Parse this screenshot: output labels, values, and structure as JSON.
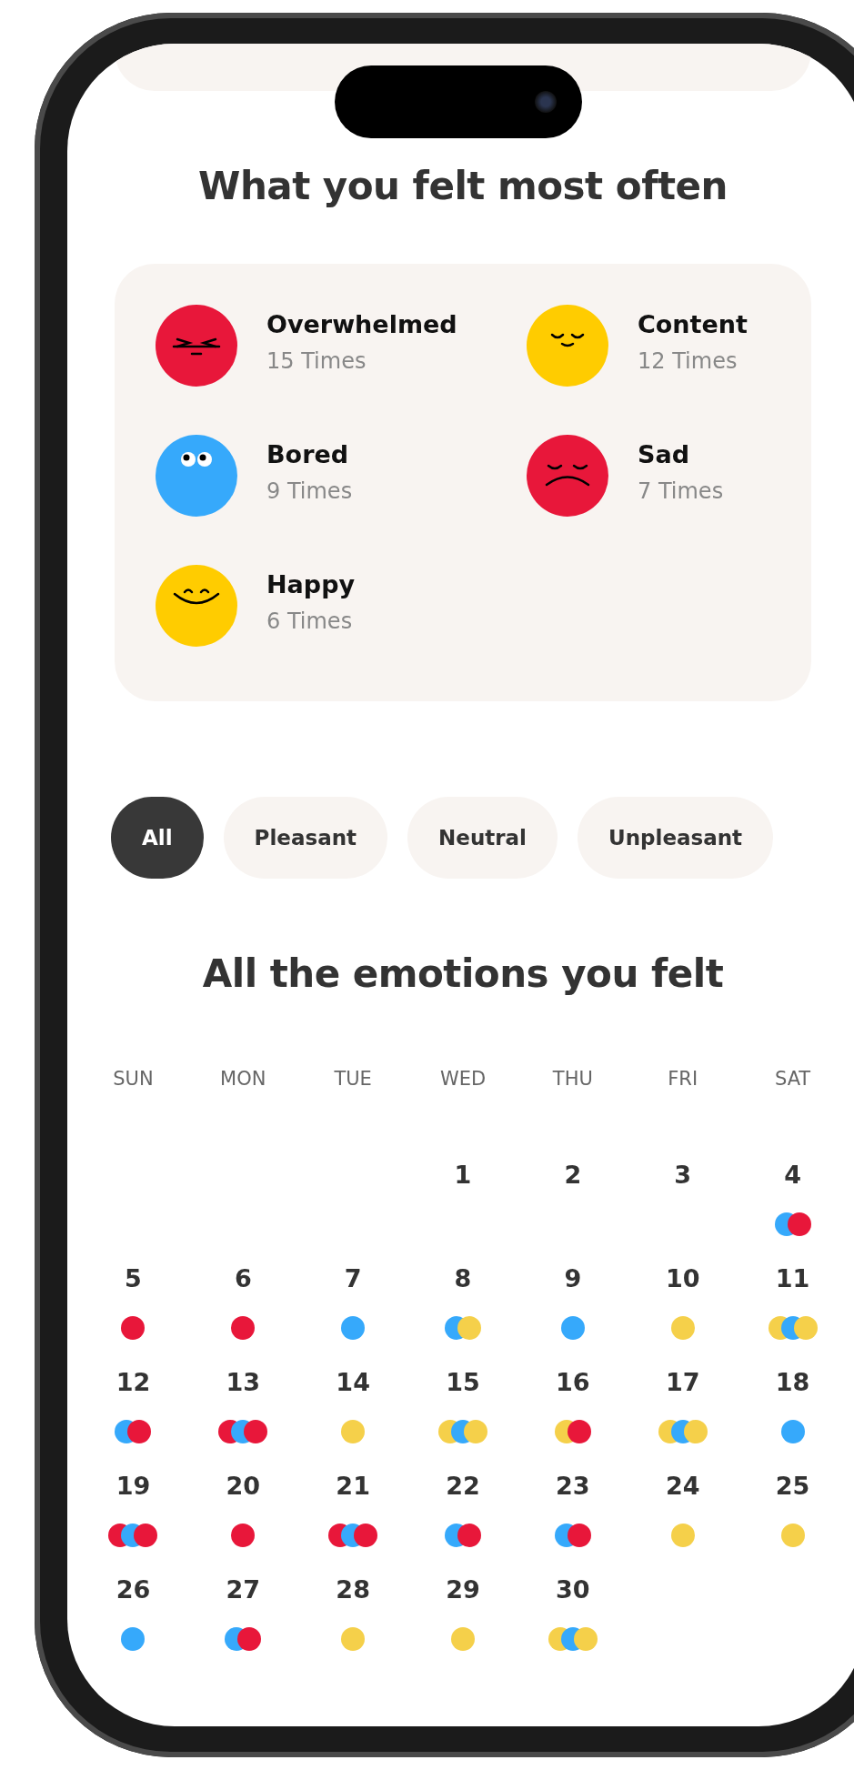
{
  "summary": {
    "title": "What you felt most often",
    "emotions": [
      {
        "name": "Overwhelmed",
        "count": "15 Times",
        "kind": "angry",
        "color": "#e8173a"
      },
      {
        "name": "Content",
        "count": "12 Times",
        "kind": "content",
        "color": "#ffcc00"
      },
      {
        "name": "Bored",
        "count": "9 Times",
        "kind": "bored",
        "color": "#36a9fb"
      },
      {
        "name": "Sad",
        "count": "7 Times",
        "kind": "sad",
        "color": "#e8173a"
      },
      {
        "name": "Happy",
        "count": "6 Times",
        "kind": "happy",
        "color": "#ffcc00"
      }
    ]
  },
  "filters": [
    {
      "label": "All",
      "selected": true
    },
    {
      "label": "Pleasant",
      "selected": false
    },
    {
      "label": "Neutral",
      "selected": false
    },
    {
      "label": "Unpleasant",
      "selected": false
    }
  ],
  "calendar": {
    "title": "All the emotions you felt",
    "weekdays": [
      "SUN",
      "MON",
      "TUE",
      "WED",
      "THU",
      "FRI",
      "SAT"
    ],
    "weeks": [
      {
        "days": [
          {
            "kind": "blank"
          },
          {
            "kind": "blank"
          },
          {
            "kind": "blank"
          },
          {
            "kind": "day",
            "date": "1"
          },
          {
            "kind": "day",
            "date": "2"
          },
          {
            "kind": "day",
            "date": "3"
          },
          {
            "kind": "day",
            "date": "4",
            "dots": [
              {
                "color": "#36a9fb"
              },
              {
                "color": "#e8173a"
              }
            ]
          }
        ]
      },
      {
        "days": [
          {
            "kind": "day",
            "date": "5",
            "dots": [
              {
                "color": "#e8173a"
              }
            ]
          },
          {
            "kind": "day",
            "date": "6",
            "dots": [
              {
                "color": "#e8173a"
              }
            ]
          },
          {
            "kind": "day",
            "date": "7",
            "dots": [
              {
                "color": "#36a9fb"
              }
            ]
          },
          {
            "kind": "day",
            "date": "8",
            "dots": [
              {
                "color": "#36a9fb"
              },
              {
                "color": "#f5d04a"
              }
            ]
          },
          {
            "kind": "day",
            "date": "9",
            "dots": [
              {
                "color": "#36a9fb"
              }
            ]
          },
          {
            "kind": "day",
            "date": "10",
            "dots": [
              {
                "color": "#f5d04a"
              }
            ]
          },
          {
            "kind": "day",
            "date": "11",
            "dots": [
              {
                "color": "#f5d04a"
              },
              {
                "color": "#36a9fb"
              },
              {
                "color": "#f5d04a"
              }
            ]
          }
        ]
      },
      {
        "days": [
          {
            "kind": "day",
            "date": "12",
            "dots": [
              {
                "color": "#36a9fb"
              },
              {
                "color": "#e8173a"
              }
            ]
          },
          {
            "kind": "day",
            "date": "13",
            "dots": [
              {
                "color": "#e8173a"
              },
              {
                "color": "#36a9fb"
              },
              {
                "color": "#e8173a"
              }
            ]
          },
          {
            "kind": "day",
            "date": "14",
            "dots": [
              {
                "color": "#f5d04a"
              }
            ]
          },
          {
            "kind": "day",
            "date": "15",
            "dots": [
              {
                "color": "#f5d04a"
              },
              {
                "color": "#36a9fb"
              },
              {
                "color": "#f5d04a"
              }
            ]
          },
          {
            "kind": "day",
            "date": "16",
            "dots": [
              {
                "color": "#f5d04a"
              },
              {
                "color": "#e8173a"
              }
            ]
          },
          {
            "kind": "day",
            "date": "17",
            "dots": [
              {
                "color": "#f5d04a"
              },
              {
                "color": "#36a9fb"
              },
              {
                "color": "#f5d04a"
              }
            ]
          },
          {
            "kind": "day",
            "date": "18",
            "dots": [
              {
                "color": "#36a9fb"
              }
            ]
          }
        ]
      },
      {
        "days": [
          {
            "kind": "day",
            "date": "19",
            "dots": [
              {
                "color": "#e8173a"
              },
              {
                "color": "#36a9fb"
              },
              {
                "color": "#e8173a"
              }
            ]
          },
          {
            "kind": "day",
            "date": "20",
            "dots": [
              {
                "color": "#e8173a"
              }
            ]
          },
          {
            "kind": "day",
            "date": "21",
            "dots": [
              {
                "color": "#e8173a"
              },
              {
                "color": "#36a9fb"
              },
              {
                "color": "#e8173a"
              }
            ]
          },
          {
            "kind": "day",
            "date": "22",
            "dots": [
              {
                "color": "#36a9fb"
              },
              {
                "color": "#e8173a"
              }
            ]
          },
          {
            "kind": "day",
            "date": "23",
            "dots": [
              {
                "color": "#36a9fb"
              },
              {
                "color": "#e8173a"
              }
            ]
          },
          {
            "kind": "day",
            "date": "24",
            "dots": [
              {
                "color": "#f5d04a"
              }
            ]
          },
          {
            "kind": "day",
            "date": "25",
            "dots": [
              {
                "color": "#f5d04a"
              }
            ]
          }
        ]
      },
      {
        "days": [
          {
            "kind": "day",
            "date": "26",
            "dots": [
              {
                "color": "#36a9fb"
              }
            ]
          },
          {
            "kind": "day",
            "date": "27",
            "dots": [
              {
                "color": "#36a9fb"
              },
              {
                "color": "#e8173a"
              }
            ]
          },
          {
            "kind": "day",
            "date": "28",
            "dots": [
              {
                "color": "#f5d04a"
              }
            ]
          },
          {
            "kind": "day",
            "date": "29",
            "dots": [
              {
                "color": "#f5d04a"
              }
            ]
          },
          {
            "kind": "day",
            "date": "30",
            "dots": [
              {
                "color": "#f5d04a"
              },
              {
                "color": "#36a9fb"
              },
              {
                "color": "#f5d04a"
              }
            ]
          }
        ]
      }
    ]
  }
}
